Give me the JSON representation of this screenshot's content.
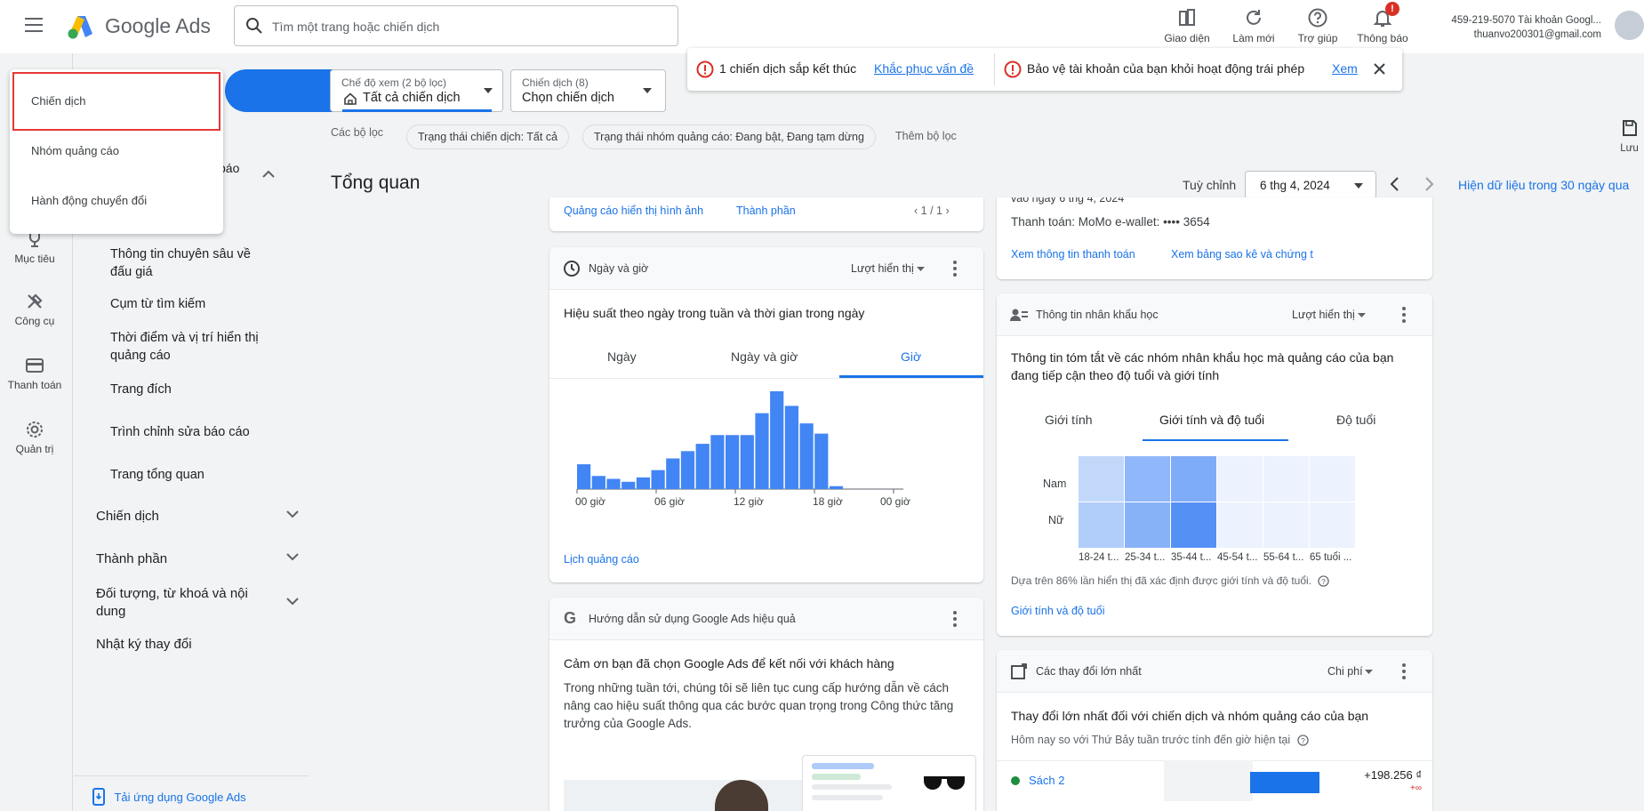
{
  "header": {
    "logo_text": "Google Ads",
    "search_placeholder": "Tìm một trang hoặc chiến dịch",
    "tools": [
      {
        "label": "Giao diện",
        "icon": "appearance-icon"
      },
      {
        "label": "Làm mới",
        "icon": "refresh-icon"
      },
      {
        "label": "Trợ giúp",
        "icon": "help-icon"
      },
      {
        "label": "Thông báo",
        "icon": "bell-icon",
        "badge": "!"
      }
    ],
    "account_line1": "459-219-5070 Tài khoản Googl...",
    "account_line2": "thuanvo200301@gmail.com"
  },
  "rail": [
    {
      "label": "Mục tiêu",
      "icon": "trophy-icon"
    },
    {
      "label": "Công cụ",
      "icon": "tools-icon"
    },
    {
      "label": "Thanh toán",
      "icon": "credit-card-icon"
    },
    {
      "label": "Quản trị",
      "icon": "gear-icon"
    }
  ],
  "nav": {
    "partial_item": "báo",
    "items": [
      "Thông tin chuyên sâu về đấu giá",
      "Cụm từ tìm kiếm",
      "Thời điểm và vị trí hiển thị quảng cáo",
      "Trang đích",
      "Trình chỉnh sửa báo cáo",
      "Trang tổng quan"
    ],
    "sections": [
      "Chiến dịch",
      "Thành phần",
      "Đối tượng, từ khoá và nội dung",
      "Nhật ký thay đổi"
    ],
    "app_link": "Tải ứng dụng Google Ads"
  },
  "dropdown": {
    "items": [
      "Chiến dịch",
      "Nhóm quảng cáo",
      "Hành động chuyển đổi"
    ]
  },
  "filters": {
    "view_label": "Chế độ xem (2 bộ lọc)",
    "view_value": "Tất cả chiến dịch",
    "campaign_label": "Chiến dịch (8)",
    "campaign_value": "Chọn chiến dịch",
    "filters_label": "Các bộ lọc",
    "chips": [
      "Trạng thái chiến dịch: Tất cả",
      "Trạng thái nhóm quảng cáo: Đang bật, Đang tạm dừng"
    ],
    "add_filter": "Thêm bộ lọc",
    "save_label": "Lưu"
  },
  "alerts": {
    "a1_text": "1 chiến dịch sắp kết thúc",
    "a1_link": "Khắc phục vấn đề",
    "a2_text": "Bảo vệ tài khoản của bạn khỏi hoạt động trái phép",
    "a2_link": "Xem"
  },
  "overview": {
    "title": "Tổng quan",
    "customize": "Tuỳ chỉnh",
    "date": "6 thg 4, 2024",
    "range_text": "Hiện dữ liệu trong 30 ngày qua"
  },
  "card_top": {
    "link1": "Quảng cáo hiển thị hình ảnh",
    "link2": "Thành phần",
    "pager": "1 / 1"
  },
  "card_time": {
    "head": "Ngày và giờ",
    "metric": "Lượt hiển thị",
    "title": "Hiệu suất theo ngày trong tuần và thời gian trong ngày",
    "tabs": [
      "Ngày",
      "Ngày và giờ",
      "Giờ"
    ],
    "link": "Lịch quảng cáo"
  },
  "chart_data": {
    "type": "bar",
    "categories": [
      "0",
      "1",
      "2",
      "3",
      "4",
      "5",
      "6",
      "7",
      "8",
      "9",
      "10",
      "11",
      "12",
      "13",
      "14",
      "15",
      "16",
      "17",
      "18",
      "19",
      "20",
      "21",
      "22",
      "23"
    ],
    "values": [
      17,
      9,
      7,
      5,
      8,
      13,
      21,
      26,
      31,
      37,
      37,
      37,
      52,
      67,
      57,
      45,
      38,
      2,
      0,
      0,
      0,
      0,
      0,
      0
    ],
    "tick_labels": [
      "00 giờ",
      "06 giờ",
      "12 giờ",
      "18 giờ",
      "00 giờ"
    ],
    "xlabel": "",
    "ylabel": "",
    "color": "#4285f4"
  },
  "card_guide": {
    "head": "Hướng dẫn sử dụng Google Ads hiệu quả",
    "title": "Cảm ơn bạn đã chọn Google Ads để kết nối với khách hàng",
    "body": "Trong những tuần tới, chúng tôi sẽ liên tục cung cấp hướng dẫn về cách nâng cao hiệu suất thông qua các bước quan trọng trong Công thức tăng trưởng của Google Ads."
  },
  "card_billing": {
    "partial": "vào ngày 6 thg 4, 2024",
    "payment": "Thanh toán: MoMo e-wallet: •••• 3654",
    "link1": "Xem thông tin thanh toán",
    "link2": "Xem bảng sao kê và chứng t"
  },
  "card_demo": {
    "head": "Thông tin nhân khẩu học",
    "metric": "Lượt hiển thị",
    "title": "Thông tin tóm tắt về các nhóm nhân khẩu học mà quảng cáo của bạn đang tiếp cận theo độ tuổi và giới tính",
    "tabs": [
      "Giới tính",
      "Giới tính và độ tuổi",
      "Độ tuổi"
    ],
    "rows": [
      "Nam",
      "Nữ"
    ],
    "cols": [
      "18-24 t...",
      "25-34 t...",
      "35-44 t...",
      "45-54 t...",
      "55-64 t...",
      "65 tuổi ..."
    ],
    "heat": [
      [
        0.3,
        0.6,
        0.7,
        0.05,
        0.05,
        0.05
      ],
      [
        0.4,
        0.65,
        0.95,
        0.05,
        0.05,
        0.05
      ]
    ],
    "note": "Dựa trên 86% lần hiển thị đã xác định được giới tính và độ tuổi.",
    "link": "Giới tính và độ tuổi"
  },
  "card_changes": {
    "head": "Các thay đổi lớn nhất",
    "metric": "Chi phí",
    "title": "Thay đổi lớn nhất đối với chiến dịch và nhóm quảng cáo của bạn",
    "subtitle": "Hôm nay so với Thứ Bảy tuần trước tính đến giờ hiện tại",
    "row_name": "Sách 2",
    "row_value": "+198.256 ₫",
    "row_pct": "+∞"
  }
}
